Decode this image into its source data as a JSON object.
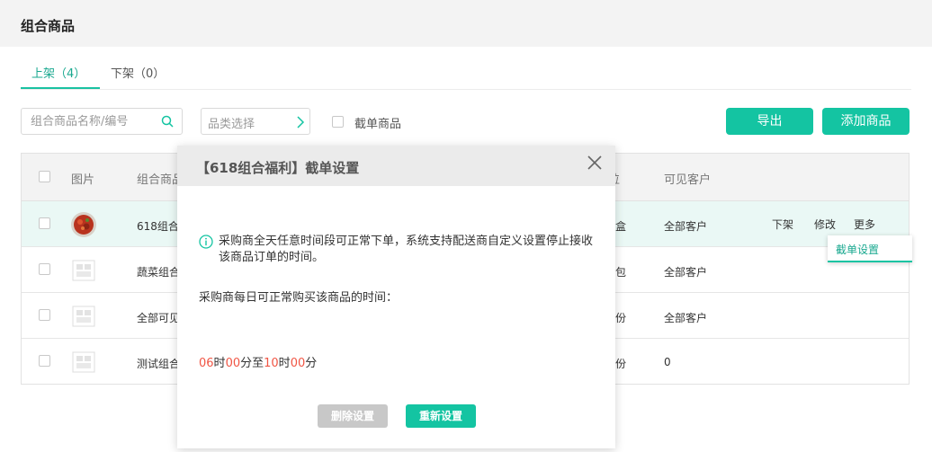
{
  "page": {
    "title": "组合商品"
  },
  "tabs": [
    {
      "label": "上架（4）",
      "active": true
    },
    {
      "label": "下架（0）",
      "active": false
    }
  ],
  "toolbar": {
    "search_placeholder": "组合商品名称/编号",
    "category_placeholder": "品类选择",
    "cutoff_filter_label": "截单商品",
    "export_label": "导出",
    "add_label": "添加商品"
  },
  "table": {
    "headers": {
      "image": "图片",
      "name": "组合商品",
      "unit": "位",
      "visible_customers": "可见客户"
    },
    "rows": [
      {
        "name": "618组合",
        "unit": "盒",
        "customers": "全部客户",
        "thumb": "food",
        "highlighted": true
      },
      {
        "name": "蔬菜组合",
        "unit": "包",
        "customers": "全部客户",
        "thumb": "placeholder",
        "highlighted": false
      },
      {
        "name": "全部可见",
        "unit": "份",
        "customers": "全部客户",
        "thumb": "placeholder",
        "highlighted": false
      },
      {
        "name": "测试组合",
        "unit": "份",
        "customers": "0",
        "thumb": "placeholder",
        "highlighted": false
      }
    ],
    "actions": {
      "offshelf": "下架",
      "edit": "修改",
      "more": "更多"
    }
  },
  "dropdown": {
    "item": "截单设置"
  },
  "modal": {
    "title": "【618组合福利】截单设置",
    "info_text": "采购商全天任意时间段可正常下单，系统支持配送商自定义设置停止接收该商品订单的时间。",
    "daily_label": "采购商每日可正常购买该商品的时间：",
    "time": {
      "start_hour": "06",
      "hour_unit": "时",
      "start_minute": "00",
      "minute_unit_to": "分至",
      "end_hour": "10",
      "end_minute": "00",
      "minute_unit": "分"
    },
    "delete_label": "删除设置",
    "reset_label": "重新设置"
  },
  "colors": {
    "accent": "#14c4a2",
    "accent_text": "#19a88f",
    "time_red": "#f05544"
  }
}
